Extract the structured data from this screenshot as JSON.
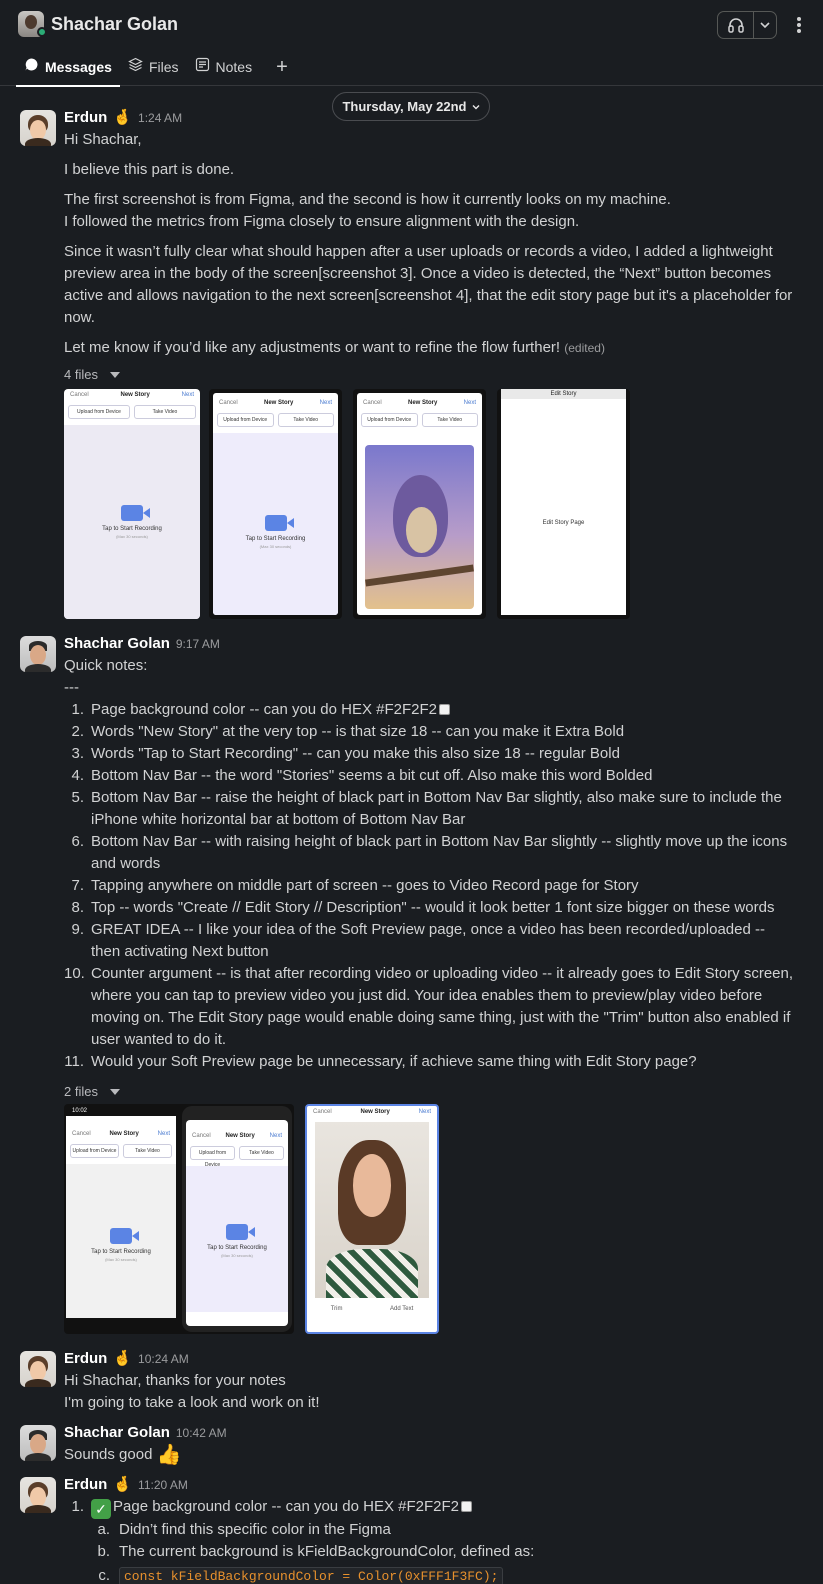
{
  "header": {
    "title": "Shachar Golan"
  },
  "tabs": [
    {
      "label": "Messages",
      "icon": "chat-bubble-icon"
    },
    {
      "label": "Files",
      "icon": "layers-icon"
    },
    {
      "label": "Notes",
      "icon": "note-icon"
    }
  ],
  "date_divider": "Thursday, May 22nd",
  "messages": {
    "m1": {
      "author": "Erdun",
      "emoji": "🤞",
      "time": "1:24 AM",
      "lines": [
        "Hi Shachar,",
        "I believe this part is done.",
        "The first screenshot is from Figma, and the second is how it currently looks on my machine.",
        "I followed the metrics from Figma closely to ensure alignment with the design.",
        "Since it wasn’t fully clear what should happen after a user uploads or records a video, I added a lightweight preview area in the body of the screen[screenshot 3]. Once a video is detected, the “Next” button becomes active and allows navigation to the next screen[screenshot 4], that the edit story page but it's a placeholder for now.",
        "Let me know if you’d like any adjustments or want to refine the flow further!"
      ],
      "edited": "(edited)",
      "files_label": "4 files"
    },
    "m2": {
      "author": "Shachar Golan",
      "time": "9:17 AM",
      "intro": "Quick notes:",
      "sep": "---",
      "items": [
        "Page background color -- can you do HEX #F2F2F2",
        "Words \"New Story\" at the very top -- is that size 18 -- can you make it Extra Bold",
        "Words \"Tap to Start Recording\" -- can you make this also size 18 -- regular Bold",
        "Bottom Nav Bar -- the word \"Stories\" seems a bit cut off. Also make this word Bolded",
        "Bottom Nav Bar -- raise the height of black part in Bottom Nav Bar slightly, also make sure to include the iPhone white horizontal bar at bottom of Bottom Nav Bar",
        "Bottom Nav Bar -- with raising height of black part in Bottom Nav Bar slightly -- slightly move up the icons and words",
        "Tapping anywhere on middle part of screen -- goes to Video Record page for Story",
        "Top -- words \"Create // Edit Story // Description\" -- would it look better 1 font size bigger on these words",
        "GREAT IDEA -- I like your idea of the Soft Preview page, once a video has been recorded/uploaded -- then activating Next button",
        "Counter argument -- is that after recording video or uploading video -- it already goes to Edit Story screen, where you can tap to preview video you just did. Your idea enables them to preview/play video before moving on. The Edit Story page would enable doing same thing, just with the \"Trim\" button also enabled if user wanted to do it.",
        "Would your Soft Preview page be unnecessary, if achieve same thing with Edit Story page?"
      ],
      "files_label": "2 files"
    },
    "m3": {
      "author": "Erdun",
      "emoji": "🤞",
      "time": "10:24 AM",
      "lines": [
        "Hi Shachar, thanks for your notes",
        "I'm going to take a look and work on it!"
      ]
    },
    "m4": {
      "author": "Shachar Golan",
      "time": "10:42 AM",
      "text": "Sounds good",
      "emoji": "👍"
    },
    "m5": {
      "author": "Erdun",
      "emoji": "🤞",
      "time": "11:20 AM",
      "item1": "Page background color -- can you do HEX #F2F2F2",
      "subitems": [
        "Didn’t find this specific color in the Figma",
        "The current background is kFieldBackgroundColor, defined as:",
        "const kFieldBackgroundColor = Color(0xFFF1F3FC);"
      ]
    }
  },
  "thumbs": {
    "cancel": "Cancel",
    "title": "New Story",
    "next": "Next",
    "upload": "Upload from Device",
    "take": "Take Video",
    "tap": "Tap to Start Recording",
    "max": "(Max 30 seconds)",
    "edit_title": "Edit Story",
    "edit_body": "Edit Story Page",
    "trim": "Trim",
    "add_text": "Add Text",
    "status_time": "10:02"
  },
  "colors": {
    "background": "#1a1d21",
    "presence": "#2bac76",
    "accent_code": "#e8912d"
  }
}
